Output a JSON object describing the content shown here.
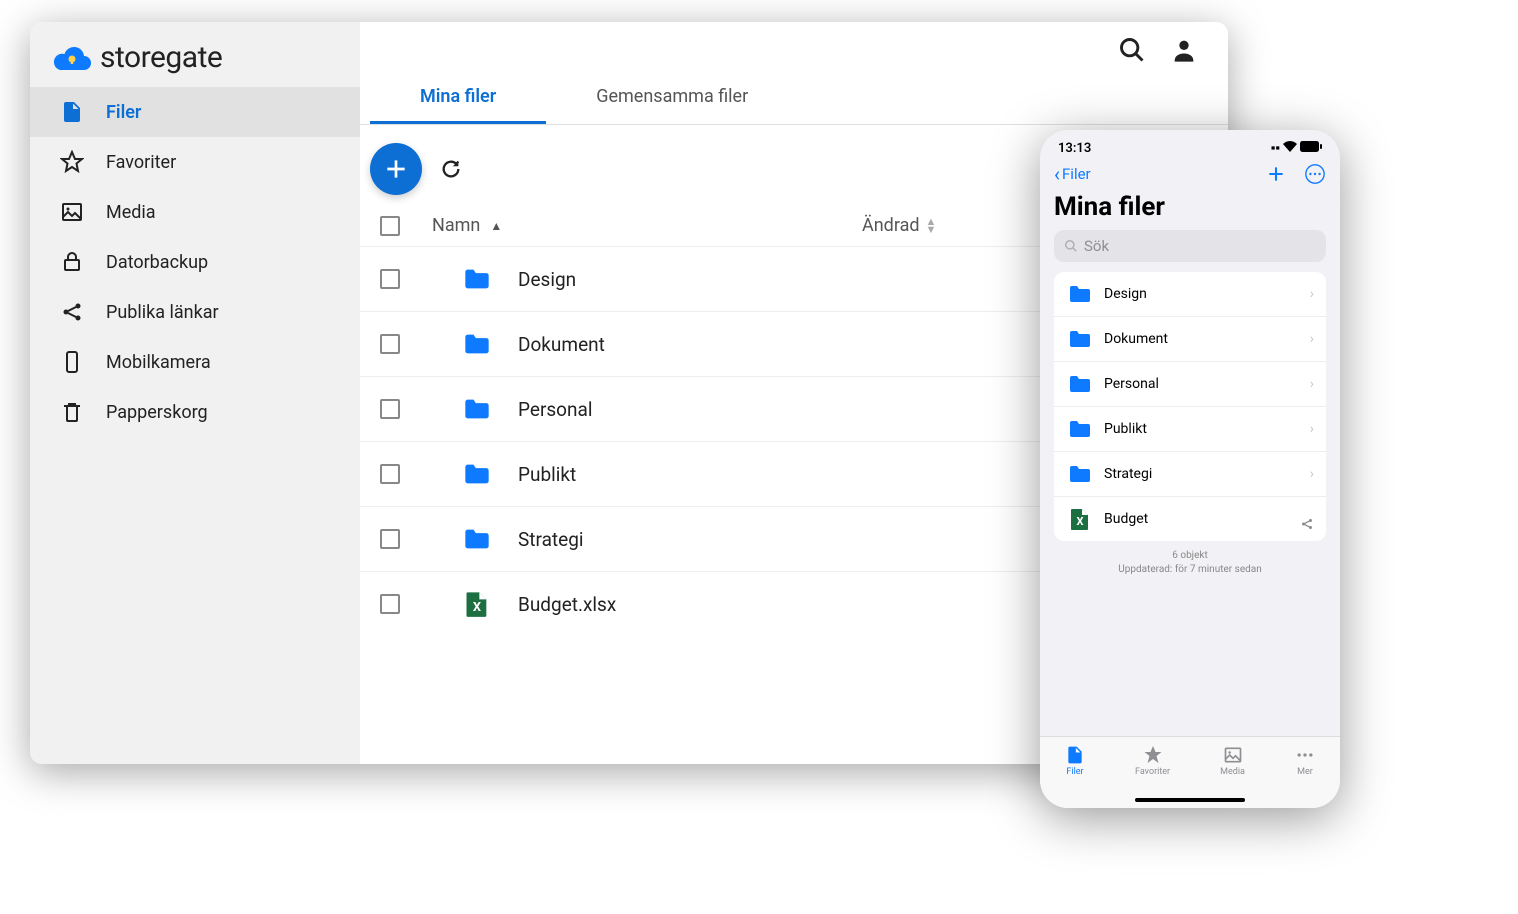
{
  "brand": "storegate",
  "sidebar": {
    "items": [
      {
        "label": "Filer",
        "icon": "file"
      },
      {
        "label": "Favoriter",
        "icon": "star"
      },
      {
        "label": "Media",
        "icon": "image"
      },
      {
        "label": "Datorbackup",
        "icon": "lock"
      },
      {
        "label": "Publika länkar",
        "icon": "share"
      },
      {
        "label": "Mobilkamera",
        "icon": "phone"
      },
      {
        "label": "Papperskorg",
        "icon": "trash"
      }
    ]
  },
  "tabs": [
    {
      "label": "Mina filer"
    },
    {
      "label": "Gemensamma filer"
    }
  ],
  "columns": {
    "name": "Namn",
    "modified": "Ändrad"
  },
  "files": [
    {
      "name": "Design",
      "type": "folder"
    },
    {
      "name": "Dokument",
      "type": "folder"
    },
    {
      "name": "Personal",
      "type": "folder"
    },
    {
      "name": "Publikt",
      "type": "folder"
    },
    {
      "name": "Strategi",
      "type": "folder"
    },
    {
      "name": "Budget.xlsx",
      "type": "excel",
      "shared": true
    }
  ],
  "mobile": {
    "time": "13:13",
    "back": "Filer",
    "title": "Mina filer",
    "search_placeholder": "Sök",
    "files": [
      {
        "name": "Design",
        "type": "folder"
      },
      {
        "name": "Dokument",
        "type": "folder"
      },
      {
        "name": "Personal",
        "type": "folder"
      },
      {
        "name": "Publikt",
        "type": "folder"
      },
      {
        "name": "Strategi",
        "type": "folder"
      },
      {
        "name": "Budget",
        "type": "excel",
        "shared": true
      }
    ],
    "footer_count": "6 objekt",
    "footer_updated": "Uppdaterad: för 7 minuter sedan",
    "tabs": [
      {
        "label": "Filer"
      },
      {
        "label": "Favoriter"
      },
      {
        "label": "Media"
      },
      {
        "label": "Mer"
      }
    ]
  }
}
